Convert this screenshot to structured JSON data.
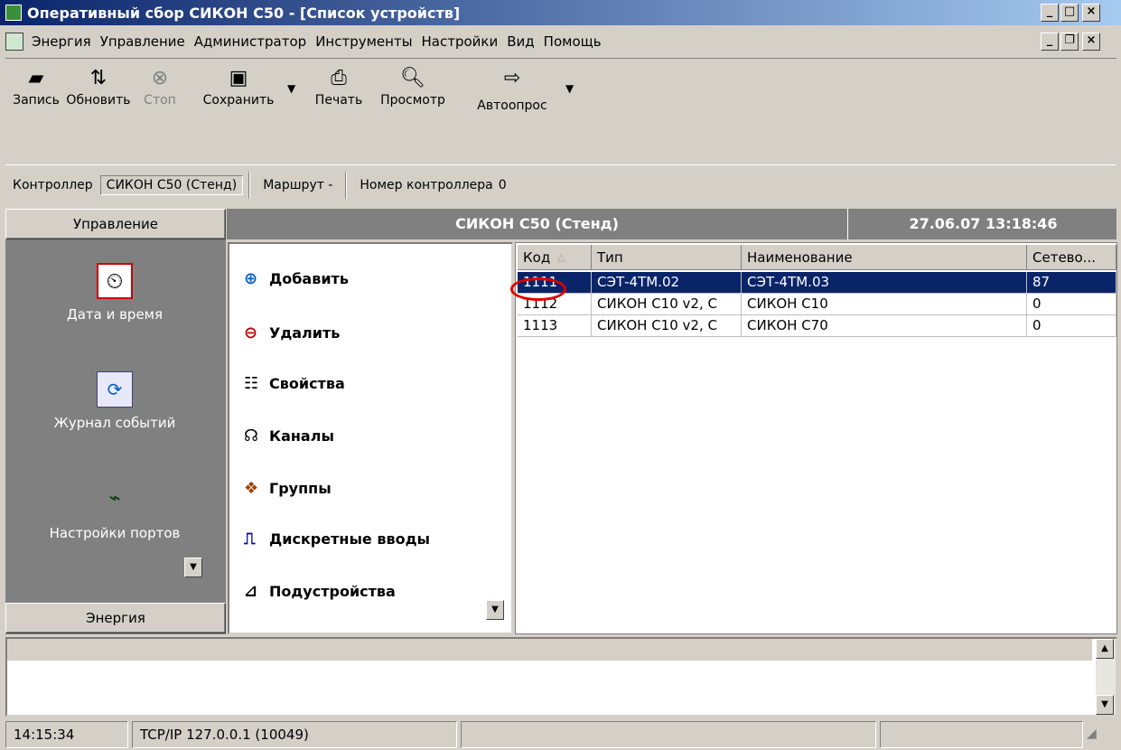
{
  "window": {
    "title": "Оперативный сбор СИКОН С50 - [Список устройств]"
  },
  "menu": [
    "Энергия",
    "Управление",
    "Администратор",
    "Инструменты",
    "Настройки",
    "Вид",
    "Помощь"
  ],
  "toolbar": {
    "record": "Запись",
    "refresh": "Обновить",
    "stop": "Стоп",
    "save": "Сохранить",
    "print": "Печать",
    "preview": "Просмотр",
    "autopoll": "Автоопрос"
  },
  "infobar": {
    "controller_label": "Контроллер",
    "controller_value": "СИКОН С50 (Стенд)",
    "route_label": "Маршрут -",
    "number_label": "Номер контроллера",
    "number_value": "0"
  },
  "leftpane": {
    "header": "Управление",
    "items": [
      "Дата и время",
      "Журнал событий",
      "Настройки портов"
    ],
    "footer": "Энергия"
  },
  "header": {
    "device": "СИКОН С50 (Стенд)",
    "datetime": "27.06.07 13:18:46"
  },
  "actions": [
    "Добавить",
    "Удалить",
    "Свойства",
    "Каналы",
    "Группы",
    "Дискретные вводы",
    "Подустройства"
  ],
  "grid": {
    "columns": [
      "Код",
      "Тип",
      "Наименование",
      "Сетево..."
    ],
    "rows": [
      [
        "1111",
        "СЭТ-4ТМ.02",
        "СЭТ-4ТМ.03",
        "87"
      ],
      [
        "1112",
        "СИКОН С10 v2, С",
        "СИКОН С10",
        "0"
      ],
      [
        "1113",
        "СИКОН С10 v2, С",
        "СИКОН С70",
        "0"
      ]
    ]
  },
  "status": {
    "time": "14:15:34",
    "connection": "TCP/IP 127.0.0.1 (10049)"
  },
  "colors": {
    "title_start": "#0a246a",
    "title_end": "#a6caf0",
    "selection": "#0a246a",
    "highlight_circle": "#e00000"
  }
}
